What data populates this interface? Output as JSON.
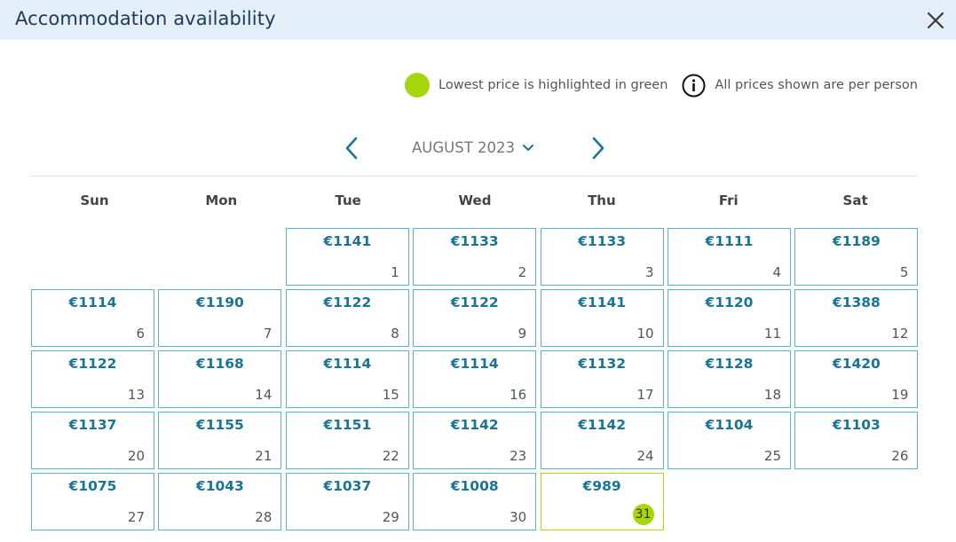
{
  "header": {
    "title": "Accommodation availability"
  },
  "legend": {
    "lowest_label": "Lowest price is highlighted in green",
    "per_person_label": "All prices shown are per person",
    "highlight_color": "#a8d60c"
  },
  "month_nav": {
    "month_label": "AUGUST 2023"
  },
  "weekdays": [
    "Sun",
    "Mon",
    "Tue",
    "Wed",
    "Thu",
    "Fri",
    "Sat"
  ],
  "days": [
    {
      "date": "1",
      "price": "€1141"
    },
    {
      "date": "2",
      "price": "€1133"
    },
    {
      "date": "3",
      "price": "€1133"
    },
    {
      "date": "4",
      "price": "€1111"
    },
    {
      "date": "5",
      "price": "€1189"
    },
    {
      "date": "6",
      "price": "€1114"
    },
    {
      "date": "7",
      "price": "€1190"
    },
    {
      "date": "8",
      "price": "€1122"
    },
    {
      "date": "9",
      "price": "€1122"
    },
    {
      "date": "10",
      "price": "€1141"
    },
    {
      "date": "11",
      "price": "€1120"
    },
    {
      "date": "12",
      "price": "€1388"
    },
    {
      "date": "13",
      "price": "€1122"
    },
    {
      "date": "14",
      "price": "€1168"
    },
    {
      "date": "15",
      "price": "€1114"
    },
    {
      "date": "16",
      "price": "€1114"
    },
    {
      "date": "17",
      "price": "€1132"
    },
    {
      "date": "18",
      "price": "€1128"
    },
    {
      "date": "19",
      "price": "€1420"
    },
    {
      "date": "20",
      "price": "€1137"
    },
    {
      "date": "21",
      "price": "€1155"
    },
    {
      "date": "22",
      "price": "€1151"
    },
    {
      "date": "23",
      "price": "€1142"
    },
    {
      "date": "24",
      "price": "€1142"
    },
    {
      "date": "25",
      "price": "€1104"
    },
    {
      "date": "26",
      "price": "€1103"
    },
    {
      "date": "27",
      "price": "€1075"
    },
    {
      "date": "28",
      "price": "€1043"
    },
    {
      "date": "29",
      "price": "€1037"
    },
    {
      "date": "30",
      "price": "€1008"
    },
    {
      "date": "31",
      "price": "€989",
      "lowest": true
    }
  ]
}
